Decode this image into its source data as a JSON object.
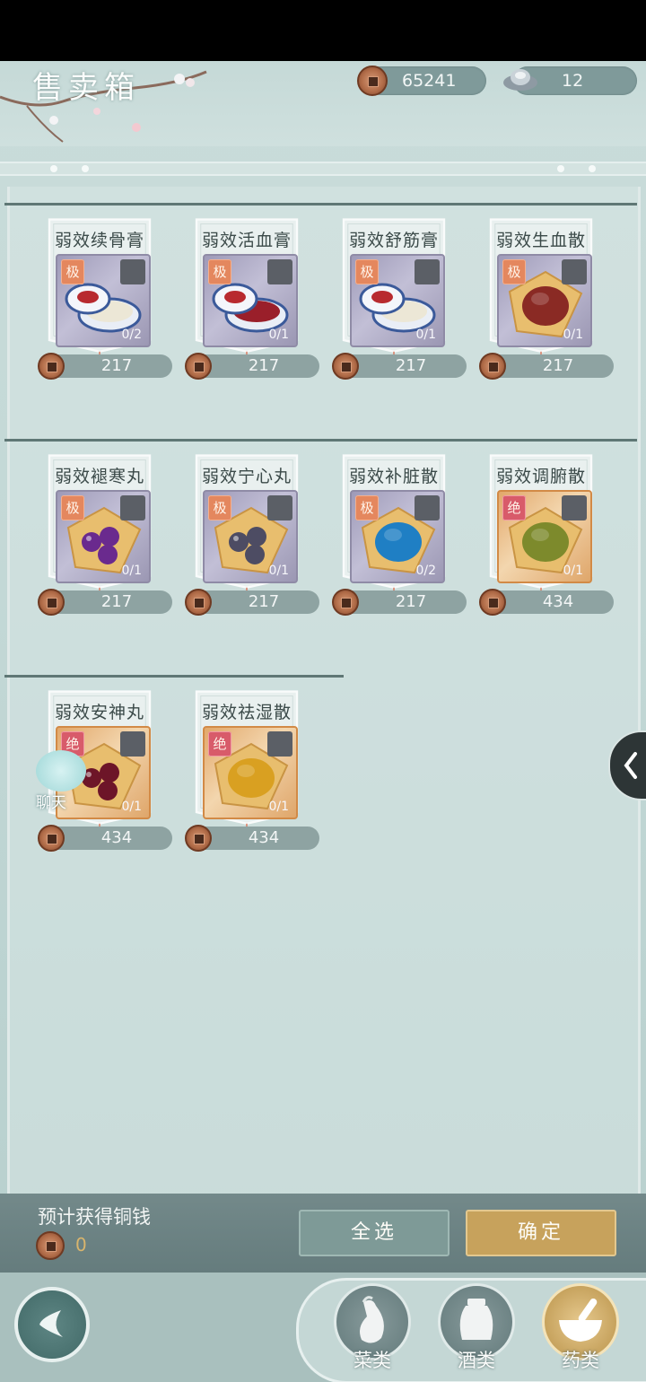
{
  "header": {
    "title": "售卖箱",
    "copper": "65241",
    "silver": "12"
  },
  "items": [
    {
      "name": "弱效续骨膏",
      "grade": "极",
      "count": "0/2",
      "price": "217",
      "icon": "ointment-jar-white-icon"
    },
    {
      "name": "弱效活血膏",
      "grade": "极",
      "count": "0/1",
      "price": "217",
      "icon": "ointment-jar-red-icon"
    },
    {
      "name": "弱效舒筋膏",
      "grade": "极",
      "count": "0/1",
      "price": "217",
      "icon": "ointment-jar-white-icon"
    },
    {
      "name": "弱效生血散",
      "grade": "极",
      "count": "0/1",
      "price": "217",
      "icon": "powder-red-icon"
    },
    {
      "name": "弱效褪寒丸",
      "grade": "极",
      "count": "0/1",
      "price": "217",
      "icon": "pills-purple-icon"
    },
    {
      "name": "弱效宁心丸",
      "grade": "极",
      "count": "0/1",
      "price": "217",
      "icon": "pills-gray-icon"
    },
    {
      "name": "弱效补脏散",
      "grade": "极",
      "count": "0/2",
      "price": "217",
      "icon": "powder-blue-icon"
    },
    {
      "name": "弱效调腑散",
      "grade": "绝",
      "count": "0/1",
      "price": "434",
      "icon": "powder-green-icon"
    },
    {
      "name": "弱效安神丸",
      "grade": "绝",
      "count": "0/1",
      "price": "434",
      "icon": "pills-dark-red-icon"
    },
    {
      "name": "弱效祛湿散",
      "grade": "绝",
      "count": "0/1",
      "price": "434",
      "icon": "powder-yellow-icon"
    }
  ],
  "footer": {
    "estimate_label": "预计获得铜钱",
    "estimate_value": "0",
    "select_all": "全选",
    "confirm": "确定"
  },
  "chat_label": "聊天",
  "categories": [
    {
      "label": "菜类",
      "icon": "eggplant-icon"
    },
    {
      "label": "酒类",
      "icon": "wine-jar-icon"
    },
    {
      "label": "药类",
      "icon": "mortar-pestle-icon"
    }
  ],
  "colors": {
    "tag_ji": "#e4875e",
    "tag_jue": "#d85b6a",
    "confirm_button": "#c7a25c",
    "select_button": "#7e9a97"
  }
}
